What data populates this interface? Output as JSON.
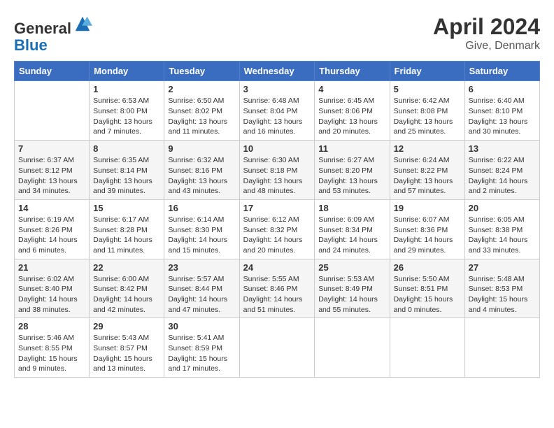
{
  "header": {
    "logo_line1": "General",
    "logo_line2": "Blue",
    "month_title": "April 2024",
    "location": "Give, Denmark"
  },
  "weekdays": [
    "Sunday",
    "Monday",
    "Tuesday",
    "Wednesday",
    "Thursday",
    "Friday",
    "Saturday"
  ],
  "weeks": [
    [
      {
        "day": "",
        "info": ""
      },
      {
        "day": "1",
        "info": "Sunrise: 6:53 AM\nSunset: 8:00 PM\nDaylight: 13 hours\nand 7 minutes."
      },
      {
        "day": "2",
        "info": "Sunrise: 6:50 AM\nSunset: 8:02 PM\nDaylight: 13 hours\nand 11 minutes."
      },
      {
        "day": "3",
        "info": "Sunrise: 6:48 AM\nSunset: 8:04 PM\nDaylight: 13 hours\nand 16 minutes."
      },
      {
        "day": "4",
        "info": "Sunrise: 6:45 AM\nSunset: 8:06 PM\nDaylight: 13 hours\nand 20 minutes."
      },
      {
        "day": "5",
        "info": "Sunrise: 6:42 AM\nSunset: 8:08 PM\nDaylight: 13 hours\nand 25 minutes."
      },
      {
        "day": "6",
        "info": "Sunrise: 6:40 AM\nSunset: 8:10 PM\nDaylight: 13 hours\nand 30 minutes."
      }
    ],
    [
      {
        "day": "7",
        "info": "Sunrise: 6:37 AM\nSunset: 8:12 PM\nDaylight: 13 hours\nand 34 minutes."
      },
      {
        "day": "8",
        "info": "Sunrise: 6:35 AM\nSunset: 8:14 PM\nDaylight: 13 hours\nand 39 minutes."
      },
      {
        "day": "9",
        "info": "Sunrise: 6:32 AM\nSunset: 8:16 PM\nDaylight: 13 hours\nand 43 minutes."
      },
      {
        "day": "10",
        "info": "Sunrise: 6:30 AM\nSunset: 8:18 PM\nDaylight: 13 hours\nand 48 minutes."
      },
      {
        "day": "11",
        "info": "Sunrise: 6:27 AM\nSunset: 8:20 PM\nDaylight: 13 hours\nand 53 minutes."
      },
      {
        "day": "12",
        "info": "Sunrise: 6:24 AM\nSunset: 8:22 PM\nDaylight: 13 hours\nand 57 minutes."
      },
      {
        "day": "13",
        "info": "Sunrise: 6:22 AM\nSunset: 8:24 PM\nDaylight: 14 hours\nand 2 minutes."
      }
    ],
    [
      {
        "day": "14",
        "info": "Sunrise: 6:19 AM\nSunset: 8:26 PM\nDaylight: 14 hours\nand 6 minutes."
      },
      {
        "day": "15",
        "info": "Sunrise: 6:17 AM\nSunset: 8:28 PM\nDaylight: 14 hours\nand 11 minutes."
      },
      {
        "day": "16",
        "info": "Sunrise: 6:14 AM\nSunset: 8:30 PM\nDaylight: 14 hours\nand 15 minutes."
      },
      {
        "day": "17",
        "info": "Sunrise: 6:12 AM\nSunset: 8:32 PM\nDaylight: 14 hours\nand 20 minutes."
      },
      {
        "day": "18",
        "info": "Sunrise: 6:09 AM\nSunset: 8:34 PM\nDaylight: 14 hours\nand 24 minutes."
      },
      {
        "day": "19",
        "info": "Sunrise: 6:07 AM\nSunset: 8:36 PM\nDaylight: 14 hours\nand 29 minutes."
      },
      {
        "day": "20",
        "info": "Sunrise: 6:05 AM\nSunset: 8:38 PM\nDaylight: 14 hours\nand 33 minutes."
      }
    ],
    [
      {
        "day": "21",
        "info": "Sunrise: 6:02 AM\nSunset: 8:40 PM\nDaylight: 14 hours\nand 38 minutes."
      },
      {
        "day": "22",
        "info": "Sunrise: 6:00 AM\nSunset: 8:42 PM\nDaylight: 14 hours\nand 42 minutes."
      },
      {
        "day": "23",
        "info": "Sunrise: 5:57 AM\nSunset: 8:44 PM\nDaylight: 14 hours\nand 47 minutes."
      },
      {
        "day": "24",
        "info": "Sunrise: 5:55 AM\nSunset: 8:46 PM\nDaylight: 14 hours\nand 51 minutes."
      },
      {
        "day": "25",
        "info": "Sunrise: 5:53 AM\nSunset: 8:49 PM\nDaylight: 14 hours\nand 55 minutes."
      },
      {
        "day": "26",
        "info": "Sunrise: 5:50 AM\nSunset: 8:51 PM\nDaylight: 15 hours\nand 0 minutes."
      },
      {
        "day": "27",
        "info": "Sunrise: 5:48 AM\nSunset: 8:53 PM\nDaylight: 15 hours\nand 4 minutes."
      }
    ],
    [
      {
        "day": "28",
        "info": "Sunrise: 5:46 AM\nSunset: 8:55 PM\nDaylight: 15 hours\nand 9 minutes."
      },
      {
        "day": "29",
        "info": "Sunrise: 5:43 AM\nSunset: 8:57 PM\nDaylight: 15 hours\nand 13 minutes."
      },
      {
        "day": "30",
        "info": "Sunrise: 5:41 AM\nSunset: 8:59 PM\nDaylight: 15 hours\nand 17 minutes."
      },
      {
        "day": "",
        "info": ""
      },
      {
        "day": "",
        "info": ""
      },
      {
        "day": "",
        "info": ""
      },
      {
        "day": "",
        "info": ""
      }
    ]
  ]
}
